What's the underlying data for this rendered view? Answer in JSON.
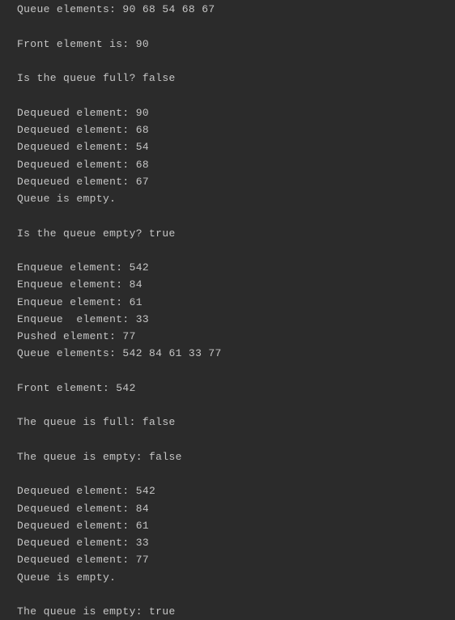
{
  "console": {
    "lines": [
      "Queue elements: 90 68 54 68 67",
      "Front element is: 90",
      "Is the queue full? false",
      "Dequeued element: 90",
      "Dequeued element: 68",
      "Dequeued element: 54",
      "Dequeued element: 68",
      "Dequeued element: 67",
      "Queue is empty.",
      "Is the queue empty? true",
      "Enqueue element: 542",
      "Enqueue element: 84",
      "Enqueue element: 61",
      "Enqueue  element: 33",
      "Pushed element: 77",
      "Queue elements: 542 84 61 33 77",
      "Front element: 542",
      "The queue is full: false",
      "The queue is empty: false",
      "Dequeued element: 542",
      "Dequeued element: 84",
      "Dequeued element: 61",
      "Dequeued element: 33",
      "Dequeued element: 77",
      "Queue is empty.",
      "The queue is empty: true"
    ]
  }
}
